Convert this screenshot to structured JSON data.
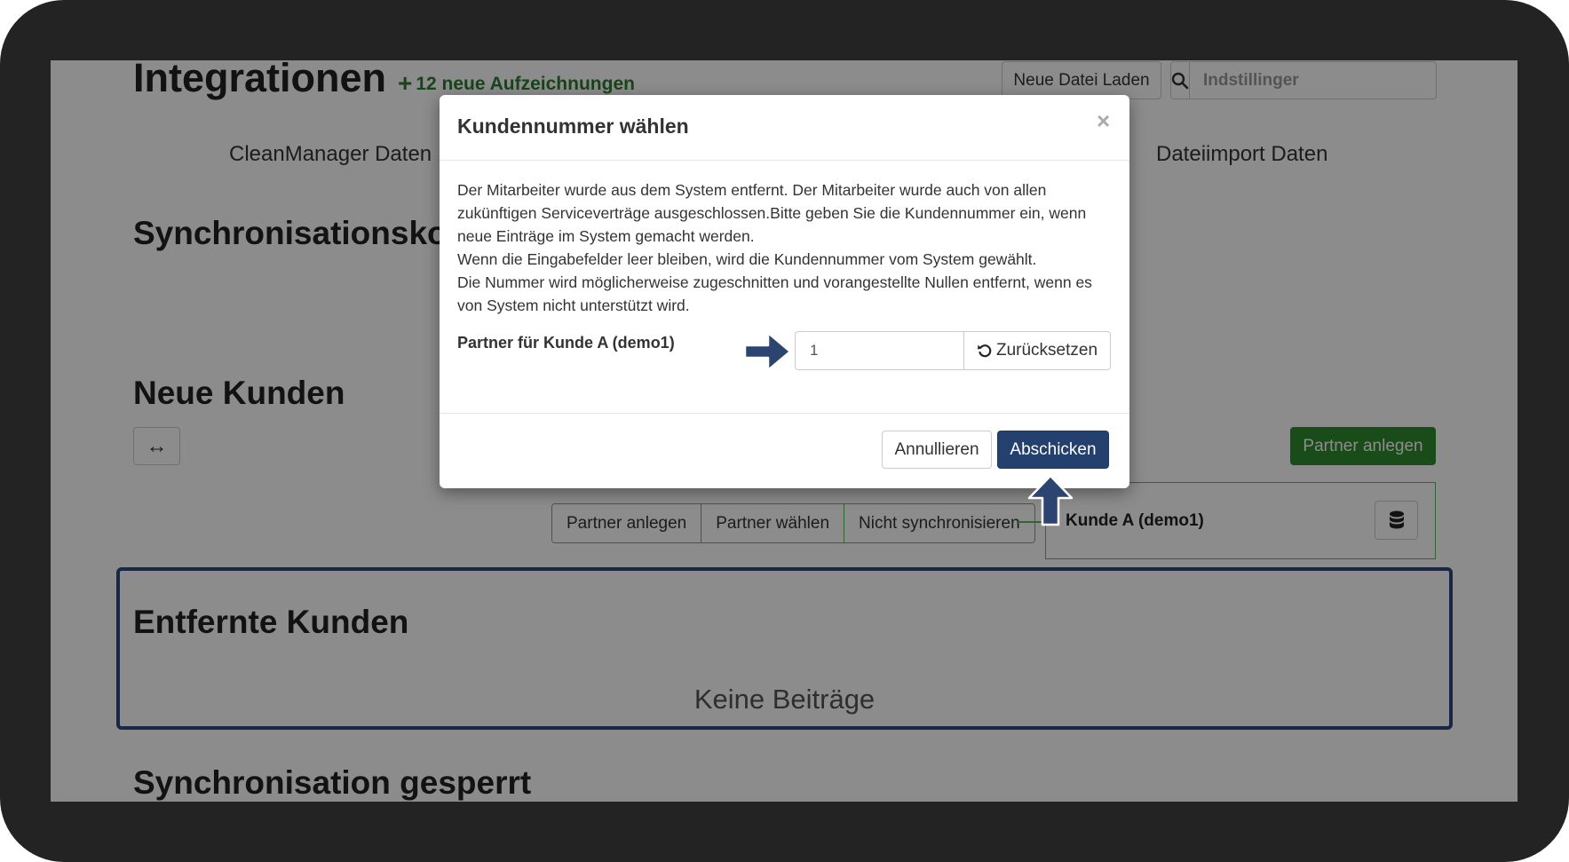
{
  "page": {
    "title": "Integrationen",
    "new_records": "12 neue Aufzeichnungen",
    "load_button": "Neue Datei Laden",
    "search_placeholder": "Indstillinger",
    "nav_left": "CleanManager Daten",
    "nav_right": "Dateiimport Daten",
    "section_sync": "Synchronisationskonflikte",
    "section_new_customers": "Neue Kunden",
    "expand_icon_glyph": "↔",
    "create_partner_button": "Partner anlegen",
    "action_buttons": [
      "Partner anlegen",
      "Partner wählen",
      "Nicht synchronisieren"
    ],
    "customer_name": "Kunde A (demo1)",
    "section_removed": "Entfernte Kunden",
    "no_entries": "Keine Beiträge",
    "section_locked": "Synchronisation gesperrt"
  },
  "modal": {
    "title": "Kundennummer wählen",
    "close": "×",
    "text_1": "Der Mitarbeiter wurde aus dem System entfernt. Der Mitarbeiter wurde auch von allen zukünftigen Serviceverträge ausgeschlossen.Bitte geben Sie die Kundennummer ein, wenn neue Einträge im System gemacht werden.",
    "text_2": "Wenn die Eingabefelder leer bleiben, wird die Kundennummer vom System gewählt.",
    "text_3": "Die Nummer wird möglicherweise zugeschnitten und vorangestellte Nullen entfernt, wenn es von System nicht unterstützt wird.",
    "field_label": "Partner für Kunde A (demo1)",
    "field_value": "1",
    "reset_button": "Zurücksetzen",
    "cancel_button": "Annullieren",
    "submit_button": "Abschicken"
  },
  "colors": {
    "frame": "#232323",
    "green_accent": "#2e8b2e",
    "navy_accent": "#23406f",
    "overlay": "rgba(0,0,0,0.45)"
  },
  "icons": {
    "search": "search-icon",
    "expand": "arrows-horizontal-icon",
    "database": "database-icon",
    "reset": "undo-icon",
    "close": "close-icon",
    "annotation_arrows": [
      "arrow-right-annotation",
      "arrow-up-annotation"
    ]
  }
}
